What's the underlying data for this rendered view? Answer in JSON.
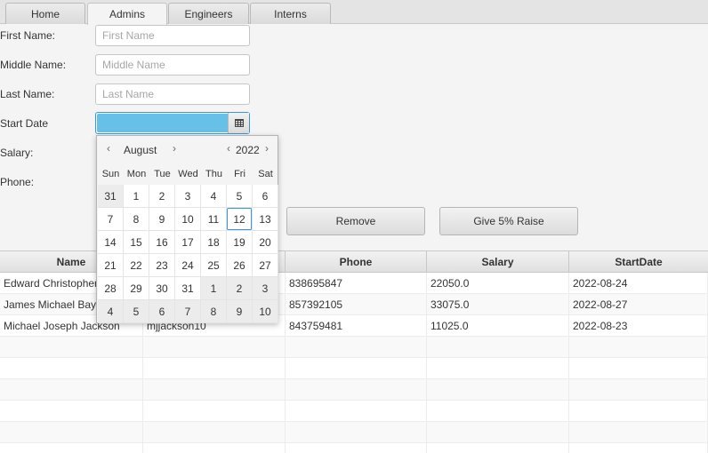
{
  "tabs": [
    "Home",
    "Admins",
    "Engineers",
    "Interns"
  ],
  "active_tab": "Admins",
  "form": {
    "first_name": {
      "label": "First Name:",
      "placeholder": "First Name"
    },
    "middle_name": {
      "label": "Middle Name:",
      "placeholder": "Middle Name"
    },
    "last_name": {
      "label": "Last Name:",
      "placeholder": "Last Name"
    },
    "start_date": {
      "label": "Start Date"
    },
    "salary": {
      "label": "Salary:"
    },
    "phone": {
      "label": "Phone:"
    }
  },
  "buttons": {
    "remove": "Remove",
    "raise": "Give 5% Raise"
  },
  "calendar": {
    "month": "August",
    "year": "2022",
    "prev_icon": "‹",
    "next_icon": "›",
    "weekdays": [
      "Sun",
      "Mon",
      "Tue",
      "Wed",
      "Thu",
      "Fri",
      "Sat"
    ],
    "weeks": [
      [
        "31",
        "1",
        "2",
        "3",
        "4",
        "5",
        "6"
      ],
      [
        "7",
        "8",
        "9",
        "10",
        "11",
        "12",
        "13"
      ],
      [
        "14",
        "15",
        "16",
        "17",
        "18",
        "19",
        "20"
      ],
      [
        "21",
        "22",
        "23",
        "24",
        "25",
        "26",
        "27"
      ],
      [
        "28",
        "29",
        "30",
        "31",
        "1",
        "2",
        "3"
      ],
      [
        "4",
        "5",
        "6",
        "7",
        "8",
        "9",
        "10"
      ]
    ],
    "today": "12"
  },
  "table": {
    "columns": [
      "Name",
      "",
      "Phone",
      "Salary",
      "StartDate"
    ],
    "rows": [
      [
        "Edward Christopher",
        "",
        "838695847",
        "22050.0",
        "2022-08-24"
      ],
      [
        "James Michael Bay",
        "",
        "857392105",
        "33075.0",
        "2022-08-27"
      ],
      [
        "Michael Joseph Jackson",
        "mjjackson10",
        "843759481",
        "11025.0",
        "2022-08-23"
      ]
    ]
  },
  "colors": {
    "accent": "#3a96d8",
    "date_input_fill": "#66c0e8"
  },
  "icons": {
    "calendar_button": "calendar-icon"
  }
}
